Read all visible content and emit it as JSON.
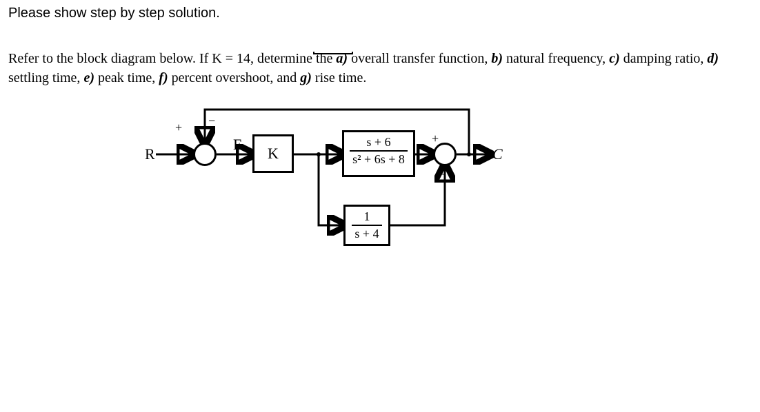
{
  "prompt": "Please show step by step solution.",
  "instruction": {
    "prefix": "Refer to the block diagram below. If K = 14, determine the ",
    "a": "a)",
    "a_txt": " overall transfer function, ",
    "b": "b)",
    "b_txt": " natural frequency, ",
    "c": "c)",
    "c_txt": " damping ratio, ",
    "d": "d)",
    "d_txt": " settling time, ",
    "e": "e)",
    "e_txt": " peak time, ",
    "f": "f)",
    "f_txt": " percent overshoot, and ",
    "g": "g)",
    "g_txt": " rise time."
  },
  "diagram": {
    "input_label": "R",
    "error_label": "E",
    "output_label": "C",
    "sum1": {
      "plus": "+",
      "minus": "−"
    },
    "sum2": {
      "plus": "+",
      "minus": "−"
    },
    "gain_block": "K",
    "plant": {
      "num": "s + 6",
      "den": "s² + 6s + 8"
    },
    "lower_block": {
      "num": "1",
      "den": "s + 4"
    },
    "K_value": 14
  }
}
